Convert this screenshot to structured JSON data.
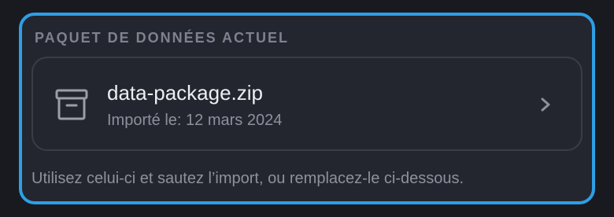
{
  "section": {
    "title": "PAQUET DE DONNÉES ACTUEL"
  },
  "file": {
    "name": "data-package.zip",
    "imported": "Importé le: 12 mars 2024",
    "icon": "archive-icon",
    "action_icon": "chevron-right-icon"
  },
  "hint": "Utilisez celui-ci et sautez l’import, ou remplacez-le ci-dessous.",
  "colors": {
    "focus_ring": "#2f9ee6",
    "panel_bg": "#23262f",
    "page_bg": "#181a20",
    "card_border": "#3a3d47",
    "title_text": "#7e828e",
    "primary_text": "#eceef2",
    "secondary_text": "#8d919c"
  }
}
